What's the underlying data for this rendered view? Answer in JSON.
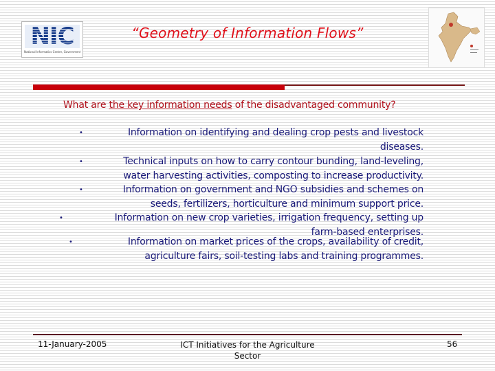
{
  "header": {
    "logo_text": "NIC",
    "logo_tagline": "National Informatics Centre, Government of India",
    "title": "“Geometry of Information Flows”"
  },
  "question": {
    "prefix": "What are ",
    "underlined": "the key information needs",
    "suffix": " of the disadvantaged community?"
  },
  "items": [
    {
      "lines": [
        "Information on identifying and dealing crop pests and livestock",
        "diseases."
      ]
    },
    {
      "lines": [
        "Technical inputs on how to carry contour bunding, land-leveling,",
        "water harvesting activities, composting to increase productivity."
      ]
    },
    {
      "lines": [
        "Information on government and NGO subsidies and schemes on",
        "seeds, fertilizers, horticulture and minimum support price."
      ]
    },
    {
      "lines": [
        "Information on new crop varieties, irrigation frequency, setting up",
        "farm-based enterprises."
      ]
    },
    {
      "lines": [
        "Information on market prices of the crops, availability of credit,",
        "agriculture fairs, soil-testing labs and training programmes."
      ]
    }
  ],
  "bullet": "•",
  "footer": {
    "date": "11-January-2005",
    "center_line1": "ICT Initiatives for the Agriculture",
    "center_line2": "Sector",
    "page": "56"
  },
  "colors": {
    "title": "#e0101a",
    "bar": "#c8000a",
    "question": "#b0101a",
    "body": "#1a1a7a"
  }
}
